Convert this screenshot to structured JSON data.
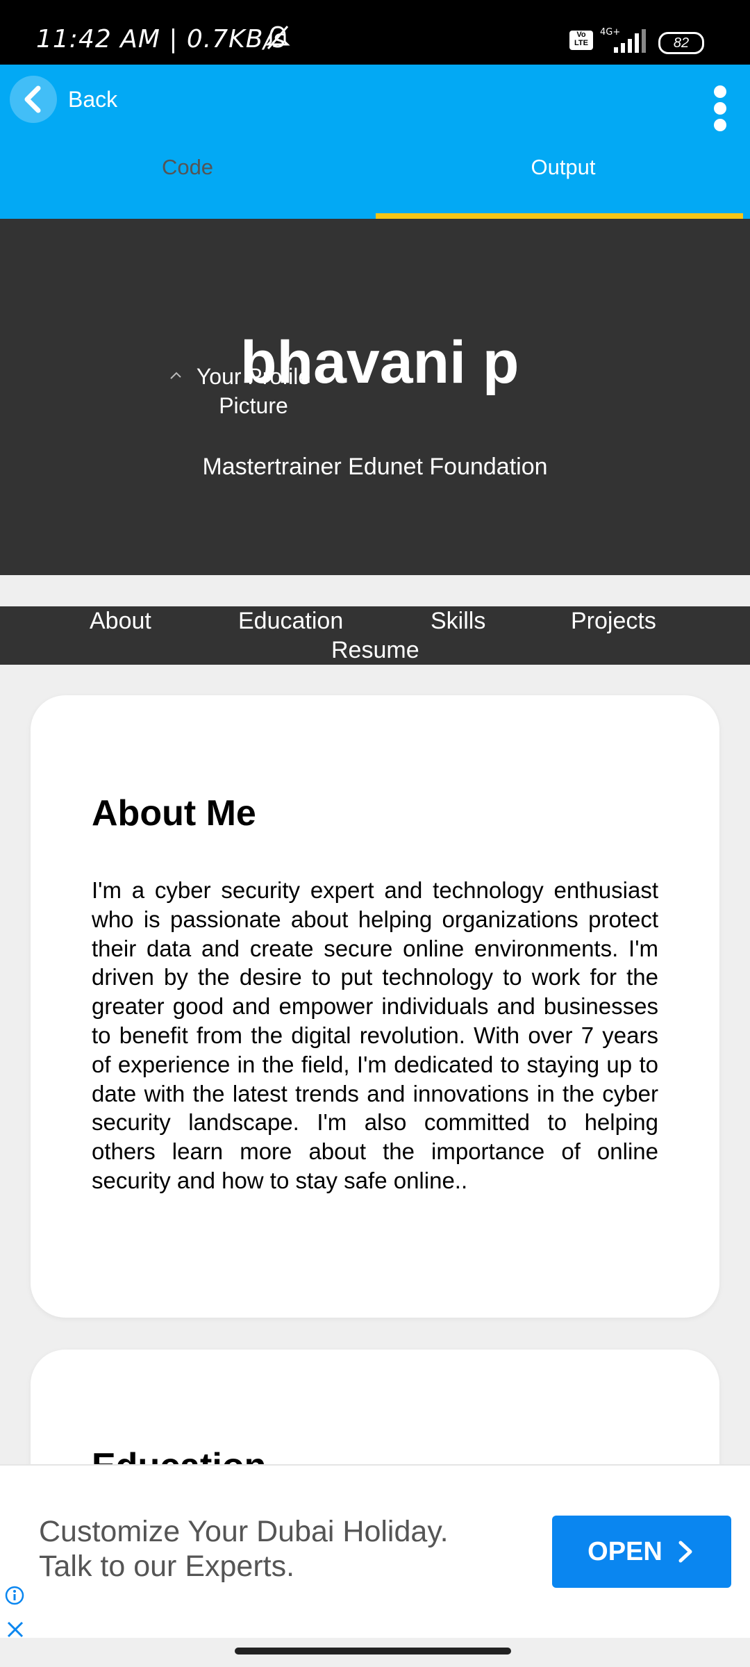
{
  "status_bar": {
    "time": "11:42 AM | 0.7KB/s",
    "network": "4G+",
    "volte": "Vo LTE",
    "battery": "82",
    "icons": [
      "bell-muted-icon",
      "signal-icon",
      "battery-icon"
    ]
  },
  "app_bar": {
    "back_label": "Back",
    "tabs": [
      {
        "label": "Code",
        "active": false
      },
      {
        "label": "Output",
        "active": true
      }
    ],
    "accent_color": "#03a9f4",
    "indicator_color": "#f5c518"
  },
  "header": {
    "picture_alt": "Your Profile Picture",
    "name": "bhavani p",
    "subtitle": "Mastertrainer Edunet Foundation"
  },
  "nav": {
    "items": [
      "About",
      "Education",
      "Skills",
      "Projects",
      "Resume"
    ]
  },
  "about": {
    "title": "About Me",
    "text": "I'm a cyber security expert and technology enthusiast who is passionate about helping organizations protect their data and create secure online environments. I'm driven by the desire to put technology to work for the greater good and empower individuals and businesses to benefit from the digital revolution. With over 7 years of experience in the field, I'm dedicated to staying up to date with the latest trends and innovations in the cyber security landscape. I'm also committed to helping others learn more about the importance of online security and how to stay safe online.."
  },
  "education": {
    "title": "Education"
  },
  "ad": {
    "line1": "Customize Your Dubai Holiday.",
    "line2": "Talk to our Experts.",
    "button_label": "OPEN",
    "button_color": "#0a86f0"
  }
}
